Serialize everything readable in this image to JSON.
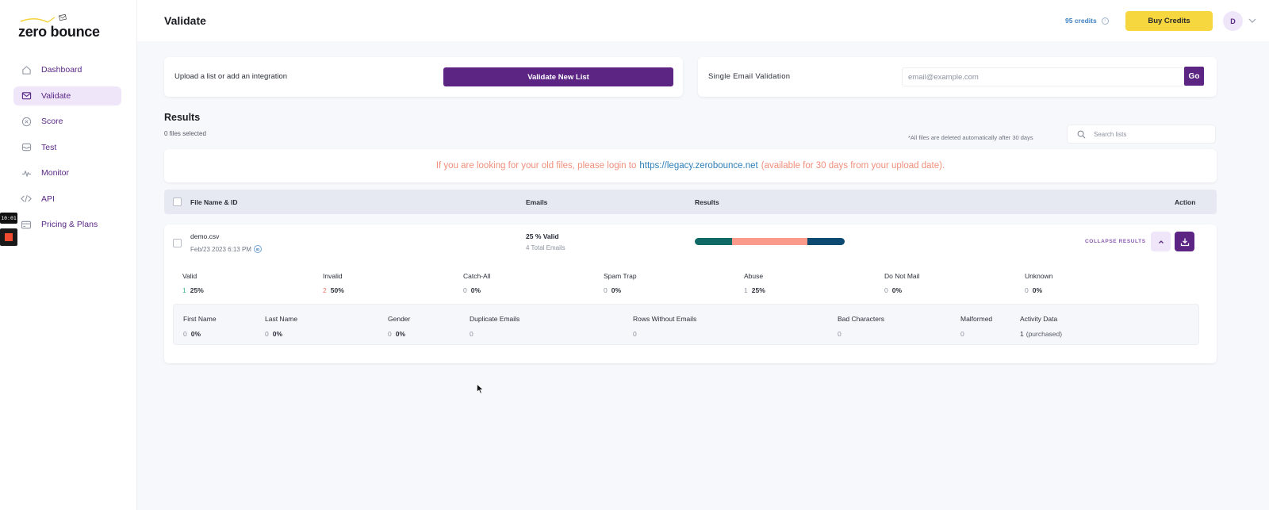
{
  "brand": {
    "logo_text": "zero bounce"
  },
  "sidebar": {
    "items": [
      {
        "label": "Dashboard",
        "icon": "home-icon",
        "active": false
      },
      {
        "label": "Validate",
        "icon": "envelope-icon",
        "active": true
      },
      {
        "label": "Score",
        "icon": "score-icon",
        "active": false
      },
      {
        "label": "Test",
        "icon": "inbox-icon",
        "active": false
      },
      {
        "label": "Monitor",
        "icon": "pulse-icon",
        "active": false
      },
      {
        "label": "API",
        "icon": "code-icon",
        "active": false
      },
      {
        "label": "Pricing & Plans",
        "icon": "credit-card-icon",
        "active": false
      }
    ]
  },
  "recorder": {
    "time": "10:01"
  },
  "header": {
    "title": "Validate",
    "credits": "95 credits",
    "buy_credits_label": "Buy Credits",
    "avatar_initial": "D"
  },
  "upload": {
    "text": "Upload a list or add an integration",
    "button_label": "Validate New List"
  },
  "single_validation": {
    "label": "Single Email Validation",
    "placeholder": "email@example.com",
    "value": "",
    "go_label": "Go"
  },
  "results": {
    "title": "Results",
    "files_selected": "0 files selected",
    "auto_delete_note": "*All files are deleted automatically after 30 days",
    "search_placeholder": "Search lists",
    "notice": {
      "before": "If you are looking for your old files, please login to",
      "link": "https://legacy.zerobounce.net",
      "after": "(available for 30 days from your upload date)."
    },
    "columns": {
      "file": "File Name & ID",
      "emails": "Emails",
      "results": "Results",
      "action": "Action"
    },
    "rows": [
      {
        "file_name": "demo.csv",
        "date": "Feb/23 2023 6:13 PM",
        "id_badge": "ID",
        "valid_summary": "25 % Valid",
        "total_emails": "4 Total Emails",
        "collapse_label": "COLLAPSE RESULTS",
        "result_bar": [
          {
            "name": "valid",
            "percent": 25,
            "color": "#0f6a66"
          },
          {
            "name": "invalid",
            "percent": 50,
            "color": "#fa9a8a"
          },
          {
            "name": "abuse",
            "percent": 25,
            "color": "#0d4a72"
          }
        ],
        "stats": [
          {
            "label": "Valid",
            "count": "1",
            "percent": "25%",
            "count_color": "#38b28a"
          },
          {
            "label": "Invalid",
            "count": "2",
            "percent": "50%",
            "count_color": "#e9735f"
          },
          {
            "label": "Catch-All",
            "count": "0",
            "percent": "0%",
            "count_color": "#8d92a0"
          },
          {
            "label": "Spam Trap",
            "count": "0",
            "percent": "0%",
            "count_color": "#8d92a0"
          },
          {
            "label": "Abuse",
            "count": "1",
            "percent": "25%",
            "count_color": "#8d92a0"
          },
          {
            "label": "Do Not Mail",
            "count": "0",
            "percent": "0%",
            "count_color": "#8d92a0"
          },
          {
            "label": "Unknown",
            "count": "0",
            "percent": "0%",
            "count_color": "#8d92a0"
          }
        ],
        "extra_stats": [
          {
            "label": "First Name",
            "count": "0",
            "percent": "0%"
          },
          {
            "label": "Last Name",
            "count": "0",
            "percent": "0%"
          },
          {
            "label": "Gender",
            "count": "0",
            "percent": "0%"
          },
          {
            "label": "Duplicate Emails",
            "count": "0",
            "percent": ""
          },
          {
            "label": "Rows Without Emails",
            "count": "0",
            "percent": ""
          },
          {
            "label": "Bad Characters",
            "count": "0",
            "percent": ""
          },
          {
            "label": "Malformed",
            "count": "0",
            "percent": ""
          },
          {
            "label": "Activity Data",
            "count": "1",
            "percent": "(purchased)"
          }
        ]
      }
    ]
  },
  "colors": {
    "brand_purple": "#5c2583",
    "accent_yellow": "#f7d73f",
    "notice_text": "#f08f7c",
    "link_blue": "#2f7fb8"
  }
}
